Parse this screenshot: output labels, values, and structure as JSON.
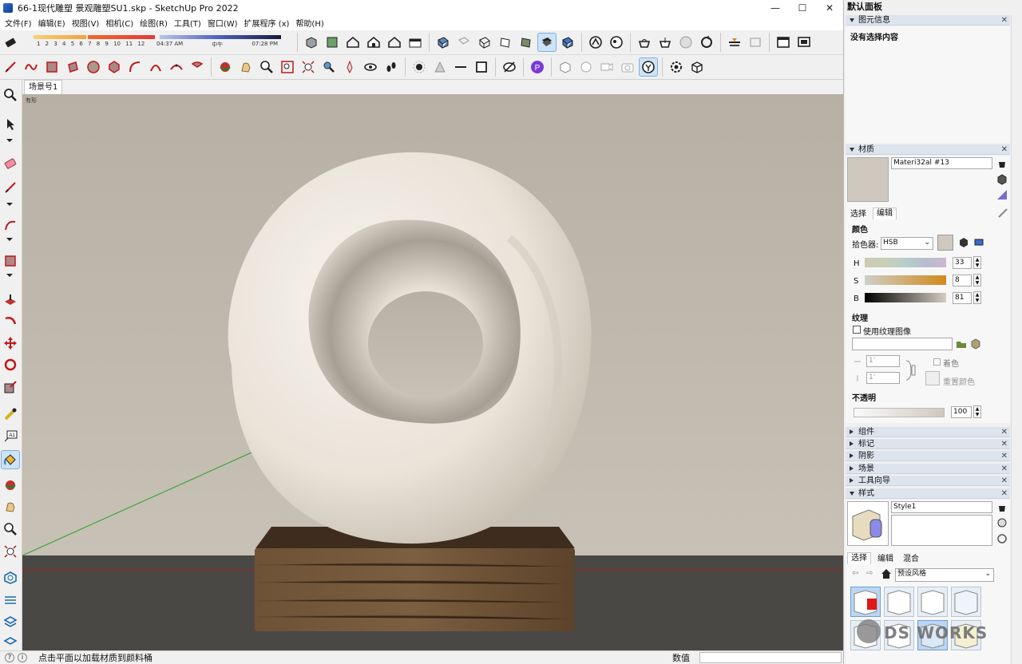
{
  "window": {
    "title": "66-1现代雕塑 景观雕塑SU1.skp - SketchUp Pro 2022",
    "minimize": "—",
    "maximize": "☐",
    "close": "✕"
  },
  "menu": [
    "文件(F)",
    "编辑(E)",
    "视图(V)",
    "相机(C)",
    "绘图(R)",
    "工具(T)",
    "窗口(W)",
    "扩展程序 (x)",
    "帮助(H)"
  ],
  "shadow": {
    "months": "1 2 3 4 5 6 7 8 9 10 11 12",
    "time_start": "04:37 AM",
    "time_mid": "中午",
    "time_end": "07:28 PM"
  },
  "scene": {
    "tab": "场景号1",
    "view_label": "有形"
  },
  "status": {
    "hint": "点击平面以加载材质到颜料桶",
    "measurement_label": "数值"
  },
  "tray": {
    "title": "默认面板",
    "entity_info": {
      "header": "图元信息",
      "text": "没有选择内容"
    },
    "materials": {
      "header": "材质",
      "name": "Materi32al #13",
      "tabs": [
        "选择",
        "编辑"
      ],
      "color_section": "颜色",
      "picker_label": "拾色器:",
      "picker_value": "HSB",
      "h_label": "H",
      "h_value": "33",
      "s_label": "S",
      "s_value": "8",
      "b_label": "B",
      "b_value": "81",
      "texture_section": "纹理",
      "use_texture": "使用纹理图像",
      "width_value": "1'",
      "height_value": "1'",
      "colorize": "着色",
      "reset_color": "重置颜色",
      "opacity_section": "不透明",
      "opacity_value": "100",
      "swatch_color": "#cfc8bf"
    },
    "collapsed_panels": [
      "组件",
      "标记",
      "阴影",
      "场景",
      "工具向导"
    ],
    "styles": {
      "header": "样式",
      "name": "Style1",
      "tabs": [
        "选择",
        "编辑",
        "混合"
      ],
      "dropdown": "预设风格"
    },
    "watermark": "DS WORKS"
  },
  "colors": {
    "wall": "#bdb6aa",
    "floor": "#4a4844",
    "sculpture": "#ece7dd",
    "base": "#6b5035",
    "accent": "#cde3f7"
  }
}
